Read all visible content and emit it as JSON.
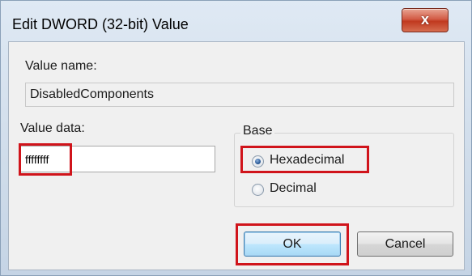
{
  "window": {
    "title": "Edit DWORD (32-bit) Value",
    "close_glyph": "x"
  },
  "value_name": {
    "label": "Value name:",
    "value": "DisabledComponents"
  },
  "value_data": {
    "label": "Value data:",
    "value": "ffffffff"
  },
  "base": {
    "legend": "Base",
    "options": [
      {
        "label": "Hexadecimal",
        "checked": true
      },
      {
        "label": "Decimal",
        "checked": false
      }
    ]
  },
  "buttons": {
    "ok_label": "OK",
    "cancel_label": "Cancel"
  },
  "highlight_color": "#d0141b",
  "icons": {
    "close": "close-icon",
    "radio_checked": "radio-checked-icon",
    "radio_unchecked": "radio-unchecked-icon"
  }
}
